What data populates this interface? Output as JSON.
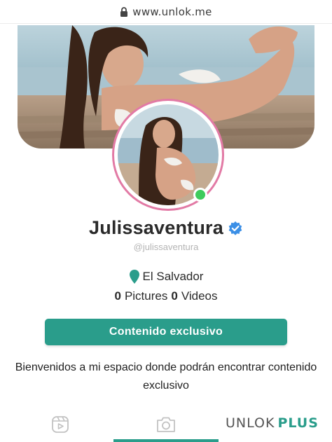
{
  "browser": {
    "url": "www.unlok.me",
    "lock_icon": "lock-icon"
  },
  "profile": {
    "display_name": "Julissaventura",
    "handle": "@julissaventura",
    "verified_icon": "verified-badge-icon",
    "online": true,
    "location": "El Salvador",
    "location_icon": "map-pin-icon",
    "pictures_count": "0",
    "pictures_label": "Pictures",
    "videos_count": "0",
    "videos_label": "Videos"
  },
  "cta": {
    "label": "Contenido exclusivo"
  },
  "bio": {
    "text": "Bienvenidos a mi espacio donde podrán encontrar contenido exclusivo"
  },
  "tabs": [
    {
      "icon": "video-play-icon",
      "active": false
    },
    {
      "icon": "camera-icon",
      "active": true
    }
  ],
  "brand_logo": {
    "name": "UNLOK",
    "suffix": "PLUS"
  },
  "colors": {
    "accent": "#2a9d8b",
    "avatar_ring": "#e27aa5",
    "online_dot": "#3ecb5c",
    "verified": "#3b8fe6",
    "location_pin": "#2a9d8b"
  }
}
